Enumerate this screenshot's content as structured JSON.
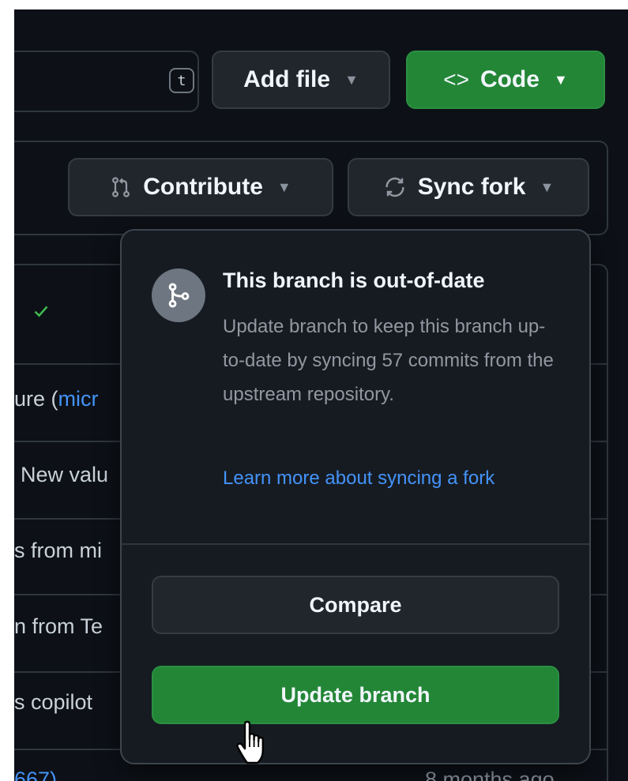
{
  "toolbar": {
    "kbd_hint": "t",
    "add_file_label": "Add file",
    "code_label": "Code",
    "code_icon": "<>"
  },
  "branch_bar": {
    "contribute_label": "Contribute",
    "sync_fork_label": "Sync fork"
  },
  "file_rows": {
    "row1": "ure (",
    "row1_link": "micr",
    "row2": "New valu",
    "row3": "s from mi",
    "row4": "n from Te",
    "row5": "s copilot",
    "row6_link": "667)",
    "row6_age": "8 months ago"
  },
  "popover": {
    "title": "This branch is out-of-date",
    "description": "Update branch to keep this branch up-to-date by syncing 57 commits from the upstream repository.",
    "learn_more": "Learn more about syncing a fork",
    "compare_label": "Compare",
    "update_label": "Update branch"
  },
  "colors": {
    "background": "#0d1117",
    "accent_green": "#238636",
    "link_blue": "#4493f8"
  }
}
